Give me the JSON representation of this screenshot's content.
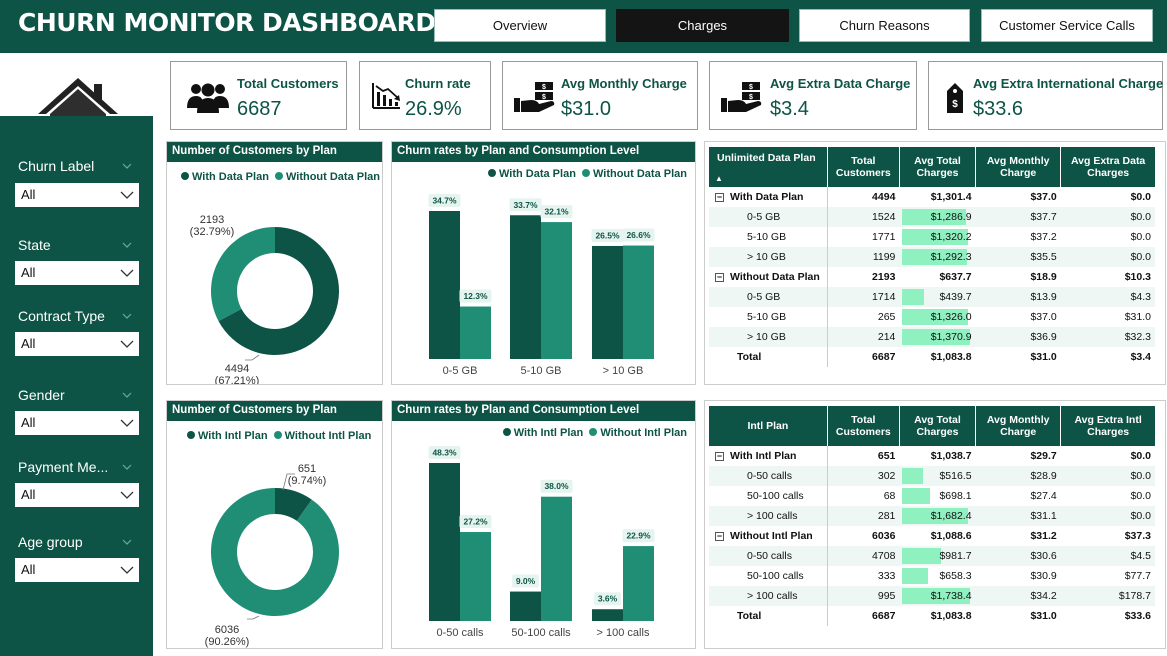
{
  "header": {
    "title": "CHURN MONITOR DASHBOARD",
    "tabs": [
      {
        "label": "Overview"
      },
      {
        "label": "Charges"
      },
      {
        "label": "Churn Reasons"
      },
      {
        "label": "Customer Service Calls"
      }
    ],
    "active_tab": "Charges"
  },
  "colors": {
    "dark": "#0d5446",
    "medium": "#1f8e75",
    "highlight": "#8ff0c0",
    "active_tab": "#141414"
  },
  "slicers": [
    {
      "label": "Churn Label",
      "value": "All"
    },
    {
      "label": "State",
      "value": "All"
    },
    {
      "label": "Contract Type",
      "value": "All"
    },
    {
      "label": "Gender",
      "value": "All"
    },
    {
      "label": "Payment Me...",
      "value": "All"
    },
    {
      "label": "Age group",
      "value": "All"
    }
  ],
  "kpis": [
    {
      "label": "Total Customers",
      "value": "6687",
      "icon": "people-icon"
    },
    {
      "label": "Churn rate",
      "value": "26.9%",
      "icon": "declining-chart-icon"
    },
    {
      "label": "Avg Monthly Charge",
      "value": "$31.0",
      "icon": "hand-money-icon"
    },
    {
      "label": "Avg Extra Data Charge",
      "value": "$3.4",
      "icon": "hand-money-icon"
    },
    {
      "label": "Avg Extra International Charge",
      "value": "$33.6",
      "icon": "price-tag-icon"
    }
  ],
  "chart_data": [
    {
      "type": "pie",
      "title": "Number of Customers by Plan",
      "categories": [
        "With Data Plan",
        "Without Data Plan"
      ],
      "values": [
        4494,
        2193
      ],
      "labels": [
        "4494",
        "2193"
      ],
      "percent_labels": [
        "(67.21%)",
        "(32.79%)"
      ],
      "donut": true
    },
    {
      "type": "bar",
      "title": "Churn rates by Plan and Consumption Level",
      "categories": [
        "0-5 GB",
        "5-10 GB",
        "> 10 GB"
      ],
      "series": [
        {
          "name": "With Data Plan",
          "values": [
            34.7,
            33.7,
            26.5
          ],
          "labels": [
            "34.7%",
            "33.7%",
            "26.5%"
          ]
        },
        {
          "name": "Without Data Plan",
          "values": [
            12.3,
            32.1,
            26.6
          ],
          "labels": [
            "12.3%",
            "32.1%",
            "26.6%"
          ]
        }
      ],
      "legend": "top-right",
      "grid": false
    },
    {
      "type": "pie",
      "title": "Number of Customers by Plan",
      "categories": [
        "With Intl Plan",
        "Without Intl Plan"
      ],
      "values": [
        651,
        6036
      ],
      "labels": [
        "651",
        "6036"
      ],
      "percent_labels": [
        "(9.74%)",
        "(90.26%)"
      ],
      "donut": true
    },
    {
      "type": "bar",
      "title": "Churn rates by Plan and Consumption Level",
      "categories": [
        "0-50 calls",
        "50-100 calls",
        "> 100 calls"
      ],
      "series": [
        {
          "name": "With Intl Plan",
          "values": [
            48.3,
            9.0,
            3.6
          ],
          "labels": [
            "48.3%",
            "9.0%",
            "3.6%"
          ]
        },
        {
          "name": "Without Intl Plan",
          "values": [
            27.2,
            38.0,
            22.9
          ],
          "labels": [
            "27.2%",
            "38.0%",
            "22.9%"
          ]
        }
      ],
      "legend": "top-right",
      "grid": false
    }
  ],
  "tables": [
    {
      "headers": [
        "Unlimited Data Plan",
        "Total Customers",
        "Avg Total Charges",
        "Avg Monthly Charge",
        "Avg Extra Data Charges"
      ],
      "sort_arrow": "▲",
      "rows": [
        {
          "kind": "grp",
          "expander": "−",
          "cells": [
            "With Data Plan",
            "4494",
            "$1,301.4",
            "$37.0",
            "$0.0"
          ]
        },
        {
          "kind": "sub",
          "bar": 1286.9,
          "cells": [
            "0-5 GB",
            "1524",
            "$1,286.9",
            "$37.7",
            "$0.0"
          ]
        },
        {
          "kind": "sub",
          "bar": 1320.2,
          "cells": [
            "5-10 GB",
            "1771",
            "$1,320.2",
            "$37.2",
            "$0.0"
          ]
        },
        {
          "kind": "sub",
          "bar": 1292.3,
          "cells": [
            "> 10 GB",
            "1199",
            "$1,292.3",
            "$35.5",
            "$0.0"
          ]
        },
        {
          "kind": "grp",
          "expander": "−",
          "cells": [
            "Without Data Plan",
            "2193",
            "$637.7",
            "$18.9",
            "$10.3"
          ]
        },
        {
          "kind": "sub",
          "bar": 439.7,
          "cells": [
            "0-5 GB",
            "1714",
            "$439.7",
            "$13.9",
            "$4.3"
          ]
        },
        {
          "kind": "sub",
          "bar": 1326.0,
          "cells": [
            "5-10 GB",
            "265",
            "$1,326.0",
            "$37.0",
            "$31.0"
          ]
        },
        {
          "kind": "sub",
          "bar": 1370.9,
          "cells": [
            "> 10 GB",
            "214",
            "$1,370.9",
            "$36.9",
            "$32.3"
          ]
        },
        {
          "kind": "tot",
          "cells": [
            "Total",
            "6687",
            "$1,083.8",
            "$31.0",
            "$3.4"
          ]
        }
      ]
    },
    {
      "headers": [
        "Intl Plan",
        "Total Customers",
        "Avg Total Charges",
        "Avg Monthly Charge",
        "Avg Extra Intl Charges"
      ],
      "rows": [
        {
          "kind": "grp",
          "expander": "−",
          "cells": [
            "With Intl Plan",
            "651",
            "$1,038.7",
            "$29.7",
            "$0.0"
          ]
        },
        {
          "kind": "sub",
          "bar": 516.5,
          "cells": [
            "0-50 calls",
            "302",
            "$516.5",
            "$28.9",
            "$0.0"
          ]
        },
        {
          "kind": "sub",
          "bar": 698.1,
          "cells": [
            "50-100 calls",
            "68",
            "$698.1",
            "$27.4",
            "$0.0"
          ]
        },
        {
          "kind": "sub",
          "bar": 1682.4,
          "cells": [
            "> 100 calls",
            "281",
            "$1,682.4",
            "$31.1",
            "$0.0"
          ]
        },
        {
          "kind": "grp",
          "expander": "−",
          "cells": [
            "Without Intl Plan",
            "6036",
            "$1,088.6",
            "$31.2",
            "$37.3"
          ]
        },
        {
          "kind": "sub",
          "bar": 981.7,
          "cells": [
            "0-50 calls",
            "4708",
            "$981.7",
            "$30.6",
            "$4.5"
          ]
        },
        {
          "kind": "sub",
          "bar": 658.3,
          "cells": [
            "50-100 calls",
            "333",
            "$658.3",
            "$30.9",
            "$77.7"
          ]
        },
        {
          "kind": "sub",
          "bar": 1738.4,
          "cells": [
            "> 100 calls",
            "995",
            "$1,738.4",
            "$34.2",
            "$178.7"
          ]
        },
        {
          "kind": "tot",
          "cells": [
            "Total",
            "6687",
            "$1,083.8",
            "$31.0",
            "$33.6"
          ]
        }
      ]
    }
  ]
}
